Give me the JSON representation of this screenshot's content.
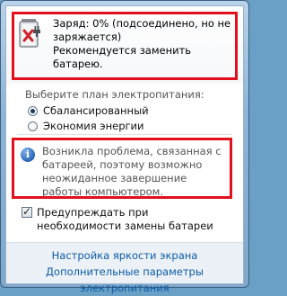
{
  "battery": {
    "icon": "battery-plug-icon",
    "status_line1": "Заряд: 0% (подсоединено, но не заряжается)",
    "status_line2": "Рекомендуется заменить батарею."
  },
  "plans": {
    "label": "Выберите план электропитания:",
    "options": [
      {
        "label": "Сбалансированный",
        "checked": true
      },
      {
        "label": "Экономия энергии",
        "checked": false
      }
    ]
  },
  "warning": {
    "icon": "info-icon",
    "text": "Возникла проблема, связанная с батареей, поэтому возможно неожиданное завершение работы компьютером."
  },
  "notify": {
    "label": "Предупреждать при необходимости замены батареи",
    "checked": true
  },
  "links": {
    "brightness": "Настройка яркости экрана",
    "more_power": "Дополнительные параметры электропитания"
  },
  "colors": {
    "highlight": "#e2101c",
    "link": "#0c5ba6"
  }
}
